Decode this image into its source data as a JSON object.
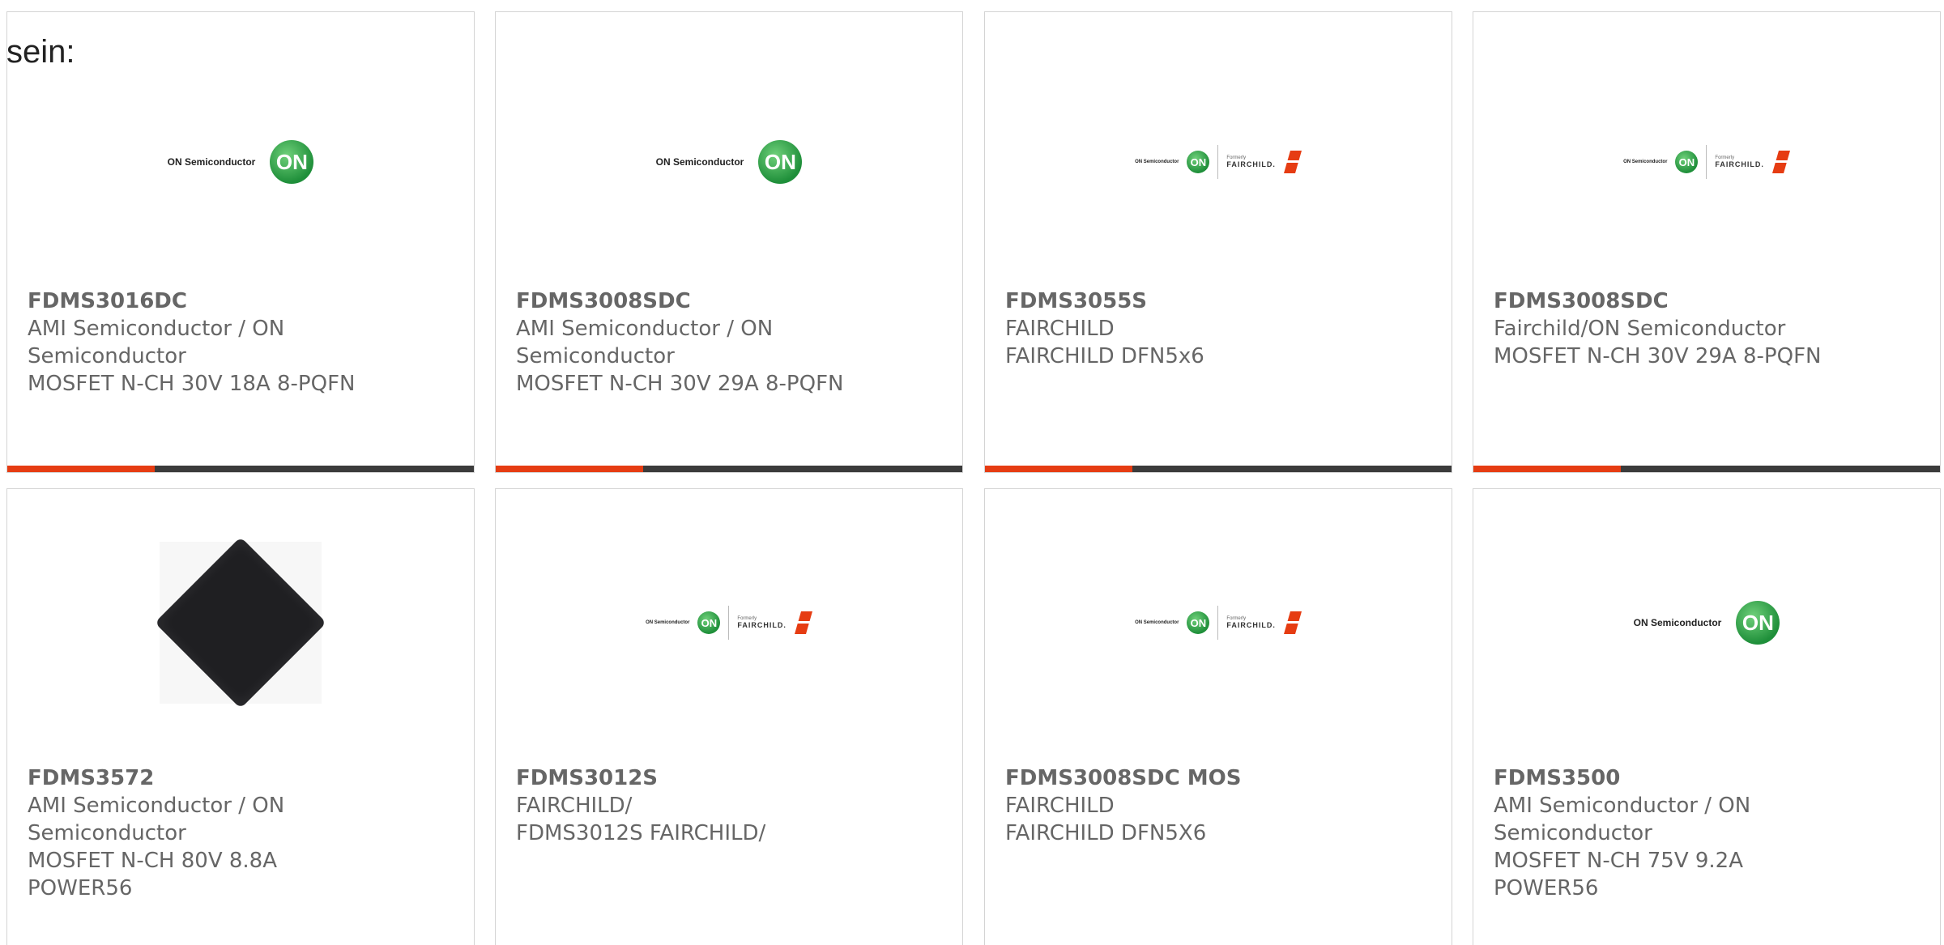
{
  "intro_text": "sein:",
  "cards": [
    {
      "part": "FDMS3016DC",
      "lines": [
        "AMI Semiconductor / ON",
        "Semiconductor",
        "MOSFET N-CH 30V 18A 8-PQFN"
      ],
      "logo": "on-semiconductor-logo"
    },
    {
      "part": "FDMS3008SDC",
      "lines": [
        "AMI Semiconductor / ON",
        "Semiconductor",
        "MOSFET N-CH 30V 29A 8-PQFN"
      ],
      "logo": "on-semiconductor-logo"
    },
    {
      "part": "FDMS3055S",
      "lines": [
        "FAIRCHILD",
        "FAIRCHILD DFN5x6"
      ],
      "logo": "on-fairchild-logo"
    },
    {
      "part": "FDMS3008SDC",
      "lines": [
        "Fairchild/ON Semiconductor",
        "MOSFET N-CH 30V 29A 8-PQFN"
      ],
      "logo": "on-fairchild-logo"
    },
    {
      "part": "FDMS3572",
      "lines": [
        "AMI Semiconductor / ON",
        "Semiconductor",
        "MOSFET N-CH 80V 8.8A",
        "POWER56"
      ],
      "logo": "chip-image"
    },
    {
      "part": "FDMS3012S",
      "lines": [
        "FAIRCHILD/",
        "FDMS3012S FAIRCHILD/"
      ],
      "logo": "on-fairchild-logo"
    },
    {
      "part": "FDMS3008SDC MOS",
      "lines": [
        "FAIRCHILD",
        "FAIRCHILD DFN5X6"
      ],
      "logo": "on-fairchild-logo"
    },
    {
      "part": "FDMS3500",
      "lines": [
        "AMI Semiconductor / ON",
        "Semiconductor",
        "MOSFET N-CH 75V 9.2A",
        "POWER56"
      ],
      "logo": "on-semiconductor-logo"
    }
  ],
  "logos": {
    "on_text": "ON Semiconductor",
    "on_mark": "ON",
    "fairchild_formerly": "Formerly",
    "fairchild_name": "FAIRCHILD."
  },
  "colors": {
    "accent": "#e63c12",
    "bar_dark": "#3b3b3b",
    "text": "#666666"
  }
}
